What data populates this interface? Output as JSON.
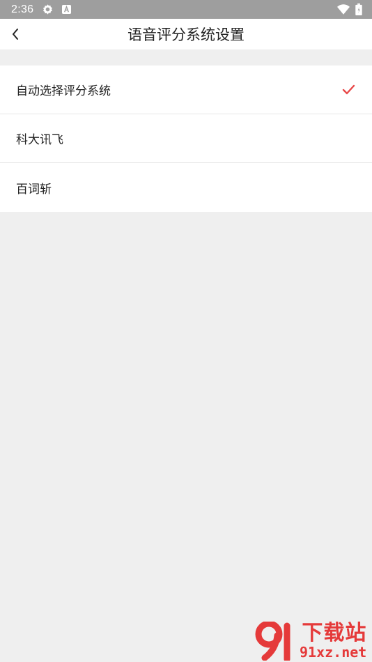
{
  "status_bar": {
    "time": "2:36",
    "left_icons": [
      "settings-gear-icon",
      "keyboard-a-icon"
    ],
    "right_icons": [
      "wifi-icon",
      "battery-icon"
    ]
  },
  "header": {
    "back_icon": "chevron-left-icon",
    "title": "语音评分系统设置"
  },
  "options": [
    {
      "label": "自动选择评分系统",
      "selected": true
    },
    {
      "label": "科大讯飞",
      "selected": false
    },
    {
      "label": "百词斩",
      "selected": false
    }
  ],
  "accent_color": "#e84a4a",
  "watermark": {
    "brand_cn": "下载站",
    "brand_en": "91xz.net"
  }
}
